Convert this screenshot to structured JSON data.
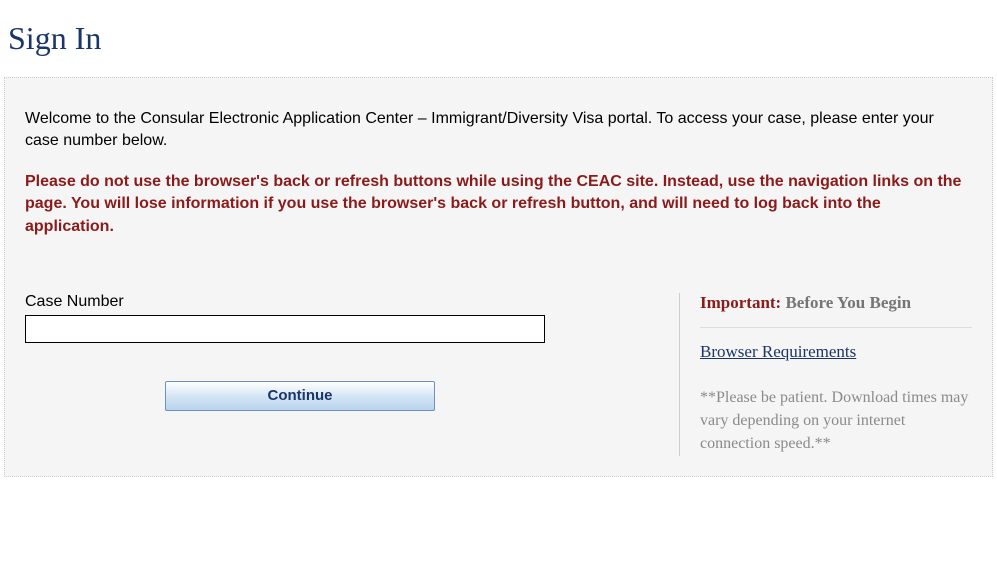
{
  "page": {
    "title": "Sign In"
  },
  "main": {
    "welcome": "Welcome to the Consular Electronic Application Center – Immigrant/Diversity Visa portal. To access your case, please enter your case number below.",
    "warning": "Please do not use the browser's back or refresh buttons while using the CEAC site. Instead, use the navigation links on the page. You will lose information if you use the browser's back or refresh button, and will need to log back into the application."
  },
  "form": {
    "case_number_label": "Case Number",
    "case_number_value": "",
    "continue_label": "Continue"
  },
  "sidebar": {
    "important_prefix": "Important:",
    "important_rest": " Before You Begin",
    "link_text": "Browser Requirements",
    "note": "**Please be patient. Download times may vary depending on your internet connection speed.**"
  }
}
